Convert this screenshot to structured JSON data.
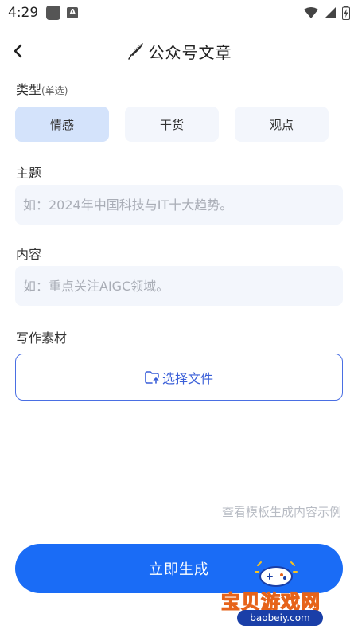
{
  "status_bar": {
    "time": "4:29",
    "app_badge": "A"
  },
  "header": {
    "title": "公众号文章",
    "title_icon": "quill-pen-icon"
  },
  "type_section": {
    "label": "类型",
    "hint": "(单选)",
    "options": [
      {
        "label": "情感",
        "selected": true
      },
      {
        "label": "干货",
        "selected": false
      },
      {
        "label": "观点",
        "selected": false
      }
    ]
  },
  "topic_section": {
    "label": "主题",
    "placeholder": "如：2024年中国科技与IT十大趋势。"
  },
  "content_section": {
    "label": "内容",
    "placeholder": "如：重点关注AIGC领域。"
  },
  "material_section": {
    "label": "写作素材",
    "upload_label": "选择文件"
  },
  "example_link": "查看模板生成内容示例",
  "generate_button": "立即生成",
  "watermark": {
    "text": "宝贝游戏网",
    "url": "baobeiy.com"
  },
  "colors": {
    "primary": "#1a6cf6",
    "chip_selected": "#d4e3fb",
    "chip_bg": "#f3f6fc",
    "upload_border": "#4a6fe3"
  }
}
